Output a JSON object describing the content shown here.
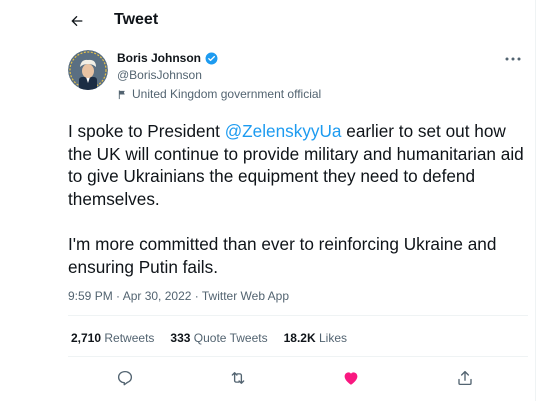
{
  "header": {
    "title": "Tweet",
    "back_icon": "arrow-left-icon"
  },
  "author": {
    "name": "Boris Johnson",
    "handle": "@BorisJohnson",
    "verified": true,
    "label": "United Kingdom government official"
  },
  "tweet": {
    "segment1": "I spoke to President ",
    "mention": "@ZelenskyyUa",
    "segment2": " earlier to set out how the UK will continue to provide military and humanitarian aid to give Ukrainians the equipment they need to defend themselves.",
    "paragraph2": "I'm more committed than ever to reinforcing Ukraine and ensuring Putin fails."
  },
  "meta": {
    "time": "9:59 PM · Apr 30, 2022 · Twitter Web App"
  },
  "stats": {
    "retweets_count": "2,710",
    "retweets_label": "Retweets",
    "quotes_count": "333",
    "quotes_label": "Quote Tweets",
    "likes_count": "18.2K",
    "likes_label": "Likes"
  },
  "colors": {
    "accent": "#1d9bf0",
    "like": "#f91880",
    "text": "#0f1419",
    "muted": "#536471",
    "border": "#eff3f4"
  }
}
